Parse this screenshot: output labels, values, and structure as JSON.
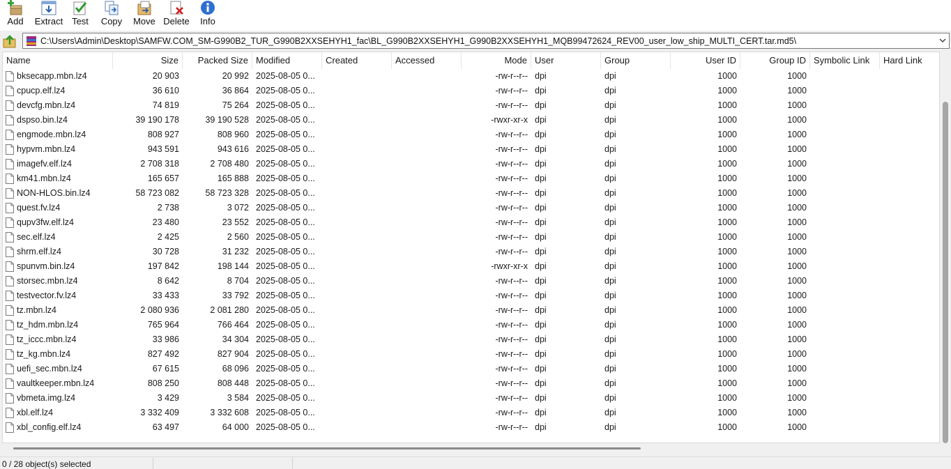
{
  "toolbar": {
    "add": "Add",
    "extract": "Extract",
    "test": "Test",
    "copy": "Copy",
    "move": "Move",
    "delete": "Delete",
    "info": "Info"
  },
  "address": {
    "path": "C:\\Users\\Admin\\Desktop\\SAMFW.COM_SM-G990B2_TUR_G990B2XXSEHYH1_fac\\BL_G990B2XXSEHYH1_G990B2XXSEHYH1_MQB99472624_REV00_user_low_ship_MULTI_CERT.tar.md5\\"
  },
  "columns": [
    "Name",
    "Size",
    "Packed Size",
    "Modified",
    "Created",
    "Accessed",
    "Mode",
    "User",
    "Group",
    "User ID",
    "Group ID",
    "Symbolic Link",
    "Hard Link"
  ],
  "files": [
    {
      "name": "bksecapp.mbn.lz4",
      "size": "20 903",
      "packed": "20 992",
      "modified": "2025-08-05 0...",
      "mode": "-rw-r--r--",
      "user": "dpi",
      "group": "dpi",
      "uid": "1000",
      "gid": "1000"
    },
    {
      "name": "cpucp.elf.lz4",
      "size": "36 610",
      "packed": "36 864",
      "modified": "2025-08-05 0...",
      "mode": "-rw-r--r--",
      "user": "dpi",
      "group": "dpi",
      "uid": "1000",
      "gid": "1000"
    },
    {
      "name": "devcfg.mbn.lz4",
      "size": "74 819",
      "packed": "75 264",
      "modified": "2025-08-05 0...",
      "mode": "-rw-r--r--",
      "user": "dpi",
      "group": "dpi",
      "uid": "1000",
      "gid": "1000"
    },
    {
      "name": "dspso.bin.lz4",
      "size": "39 190 178",
      "packed": "39 190 528",
      "modified": "2025-08-05 0...",
      "mode": "-rwxr-xr-x",
      "user": "dpi",
      "group": "dpi",
      "uid": "1000",
      "gid": "1000"
    },
    {
      "name": "engmode.mbn.lz4",
      "size": "808 927",
      "packed": "808 960",
      "modified": "2025-08-05 0...",
      "mode": "-rw-r--r--",
      "user": "dpi",
      "group": "dpi",
      "uid": "1000",
      "gid": "1000"
    },
    {
      "name": "hypvm.mbn.lz4",
      "size": "943 591",
      "packed": "943 616",
      "modified": "2025-08-05 0...",
      "mode": "-rw-r--r--",
      "user": "dpi",
      "group": "dpi",
      "uid": "1000",
      "gid": "1000"
    },
    {
      "name": "imagefv.elf.lz4",
      "size": "2 708 318",
      "packed": "2 708 480",
      "modified": "2025-08-05 0...",
      "mode": "-rw-r--r--",
      "user": "dpi",
      "group": "dpi",
      "uid": "1000",
      "gid": "1000"
    },
    {
      "name": "km41.mbn.lz4",
      "size": "165 657",
      "packed": "165 888",
      "modified": "2025-08-05 0...",
      "mode": "-rw-r--r--",
      "user": "dpi",
      "group": "dpi",
      "uid": "1000",
      "gid": "1000"
    },
    {
      "name": "NON-HLOS.bin.lz4",
      "size": "58 723 082",
      "packed": "58 723 328",
      "modified": "2025-08-05 0...",
      "mode": "-rw-r--r--",
      "user": "dpi",
      "group": "dpi",
      "uid": "1000",
      "gid": "1000"
    },
    {
      "name": "quest.fv.lz4",
      "size": "2 738",
      "packed": "3 072",
      "modified": "2025-08-05 0...",
      "mode": "-rw-r--r--",
      "user": "dpi",
      "group": "dpi",
      "uid": "1000",
      "gid": "1000"
    },
    {
      "name": "qupv3fw.elf.lz4",
      "size": "23 480",
      "packed": "23 552",
      "modified": "2025-08-05 0...",
      "mode": "-rw-r--r--",
      "user": "dpi",
      "group": "dpi",
      "uid": "1000",
      "gid": "1000"
    },
    {
      "name": "sec.elf.lz4",
      "size": "2 425",
      "packed": "2 560",
      "modified": "2025-08-05 0...",
      "mode": "-rw-r--r--",
      "user": "dpi",
      "group": "dpi",
      "uid": "1000",
      "gid": "1000"
    },
    {
      "name": "shrm.elf.lz4",
      "size": "30 728",
      "packed": "31 232",
      "modified": "2025-08-05 0...",
      "mode": "-rw-r--r--",
      "user": "dpi",
      "group": "dpi",
      "uid": "1000",
      "gid": "1000"
    },
    {
      "name": "spunvm.bin.lz4",
      "size": "197 842",
      "packed": "198 144",
      "modified": "2025-08-05 0...",
      "mode": "-rwxr-xr-x",
      "user": "dpi",
      "group": "dpi",
      "uid": "1000",
      "gid": "1000"
    },
    {
      "name": "storsec.mbn.lz4",
      "size": "8 642",
      "packed": "8 704",
      "modified": "2025-08-05 0...",
      "mode": "-rw-r--r--",
      "user": "dpi",
      "group": "dpi",
      "uid": "1000",
      "gid": "1000"
    },
    {
      "name": "testvector.fv.lz4",
      "size": "33 433",
      "packed": "33 792",
      "modified": "2025-08-05 0...",
      "mode": "-rw-r--r--",
      "user": "dpi",
      "group": "dpi",
      "uid": "1000",
      "gid": "1000"
    },
    {
      "name": "tz.mbn.lz4",
      "size": "2 080 936",
      "packed": "2 081 280",
      "modified": "2025-08-05 0...",
      "mode": "-rw-r--r--",
      "user": "dpi",
      "group": "dpi",
      "uid": "1000",
      "gid": "1000"
    },
    {
      "name": "tz_hdm.mbn.lz4",
      "size": "765 964",
      "packed": "766 464",
      "modified": "2025-08-05 0...",
      "mode": "-rw-r--r--",
      "user": "dpi",
      "group": "dpi",
      "uid": "1000",
      "gid": "1000"
    },
    {
      "name": "tz_iccc.mbn.lz4",
      "size": "33 986",
      "packed": "34 304",
      "modified": "2025-08-05 0...",
      "mode": "-rw-r--r--",
      "user": "dpi",
      "group": "dpi",
      "uid": "1000",
      "gid": "1000"
    },
    {
      "name": "tz_kg.mbn.lz4",
      "size": "827 492",
      "packed": "827 904",
      "modified": "2025-08-05 0...",
      "mode": "-rw-r--r--",
      "user": "dpi",
      "group": "dpi",
      "uid": "1000",
      "gid": "1000"
    },
    {
      "name": "uefi_sec.mbn.lz4",
      "size": "67 615",
      "packed": "68 096",
      "modified": "2025-08-05 0...",
      "mode": "-rw-r--r--",
      "user": "dpi",
      "group": "dpi",
      "uid": "1000",
      "gid": "1000"
    },
    {
      "name": "vaultkeeper.mbn.lz4",
      "size": "808 250",
      "packed": "808 448",
      "modified": "2025-08-05 0...",
      "mode": "-rw-r--r--",
      "user": "dpi",
      "group": "dpi",
      "uid": "1000",
      "gid": "1000"
    },
    {
      "name": "vbmeta.img.lz4",
      "size": "3 429",
      "packed": "3 584",
      "modified": "2025-08-05 0...",
      "mode": "-rw-r--r--",
      "user": "dpi",
      "group": "dpi",
      "uid": "1000",
      "gid": "1000"
    },
    {
      "name": "xbl.elf.lz4",
      "size": "3 332 409",
      "packed": "3 332 608",
      "modified": "2025-08-05 0...",
      "mode": "-rw-r--r--",
      "user": "dpi",
      "group": "dpi",
      "uid": "1000",
      "gid": "1000"
    },
    {
      "name": "xbl_config.elf.lz4",
      "size": "63 497",
      "packed": "64 000",
      "modified": "2025-08-05 0...",
      "mode": "-rw-r--r--",
      "user": "dpi",
      "group": "dpi",
      "uid": "1000",
      "gid": "1000"
    }
  ],
  "status": {
    "selection": "0 / 28 object(s) selected"
  },
  "colors": {
    "window_bg": "#f0f0f0",
    "list_bg": "#ffffff",
    "path_border": "#7a7a7a"
  }
}
